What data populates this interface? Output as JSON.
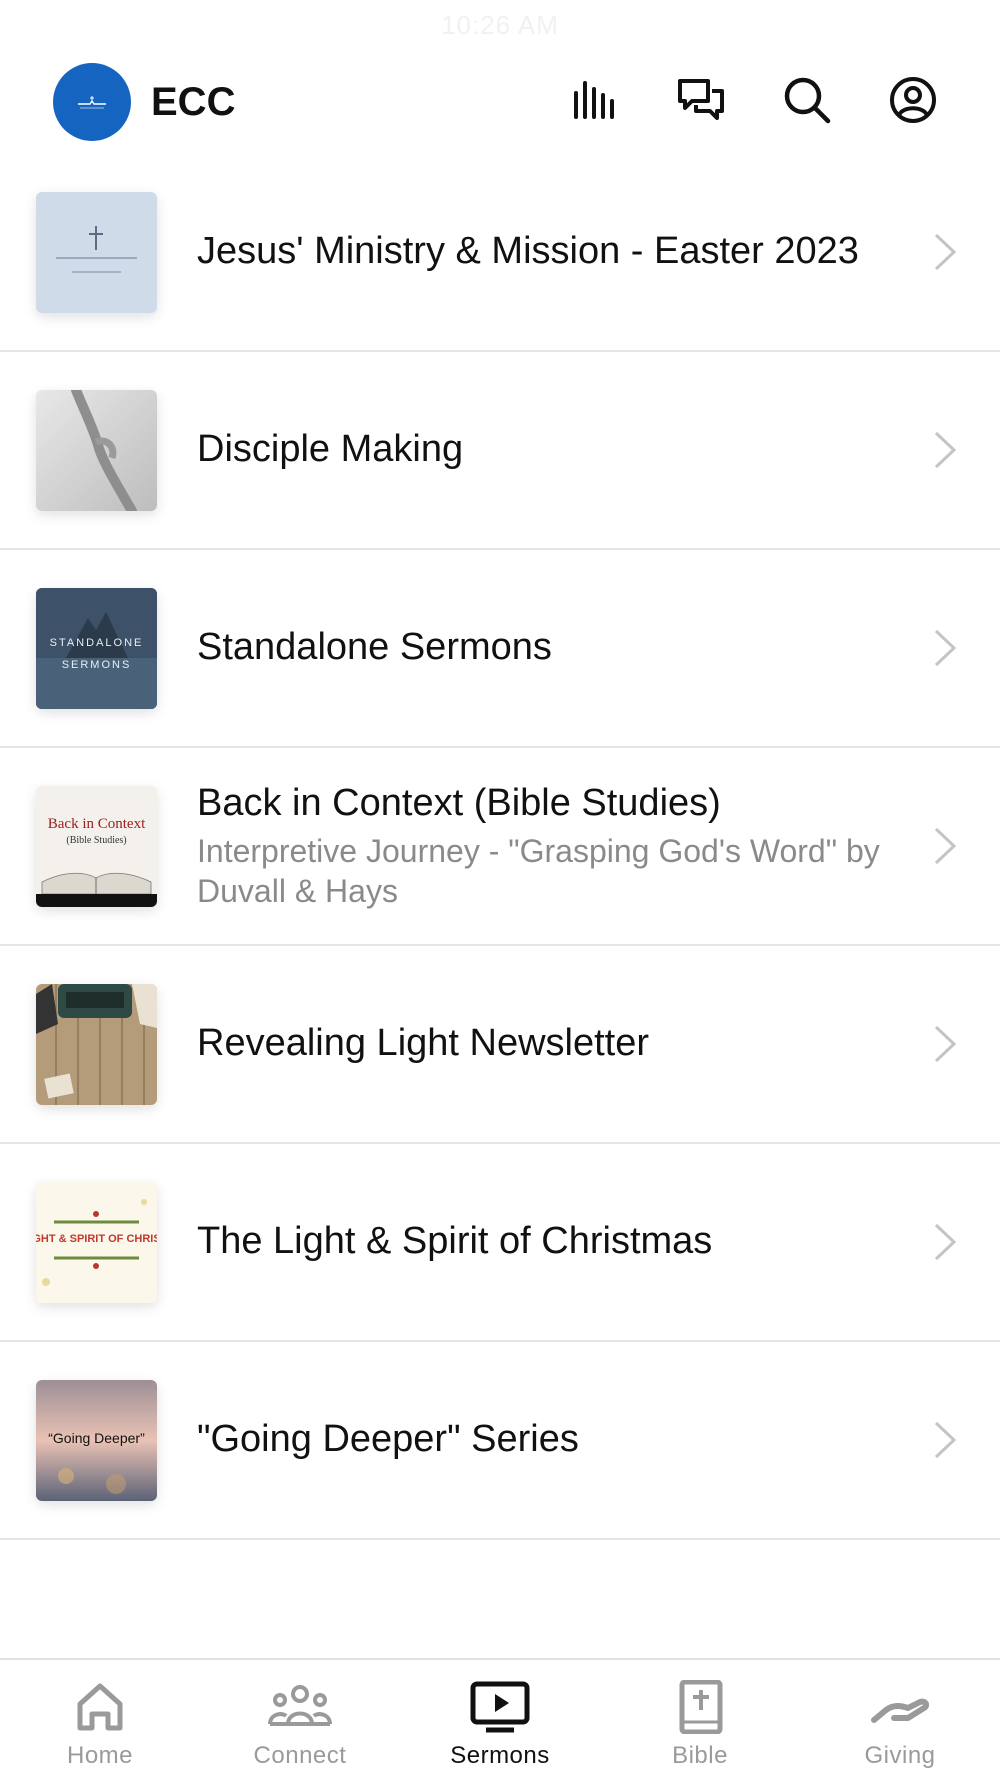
{
  "status_bar": {
    "time": "10:26 AM"
  },
  "header": {
    "app_name": "ECC",
    "icons": [
      "audio-bars-icon",
      "chat-icon",
      "search-icon",
      "account-icon"
    ]
  },
  "list": {
    "items": [
      {
        "title": "Jesus' Ministry & Mission - Easter 2023",
        "subtitle": "",
        "thumb_icon": "ministry-mission-thumbnail"
      },
      {
        "title": "Disciple Making",
        "subtitle": "",
        "thumb_icon": "hands-thumbnail"
      },
      {
        "title": "Standalone Sermons",
        "subtitle": "",
        "thumb_icon": "standalone-sermons-thumbnail",
        "thumb_text": [
          "STANDALONE",
          "SERMONS"
        ]
      },
      {
        "title": "Back in Context (Bible Studies)",
        "subtitle": "Interpretive Journey - \"Grasping God's Word\" by Duvall & Hays",
        "thumb_icon": "back-in-context-thumbnail",
        "thumb_text": [
          "Back in Context",
          "(Bible Studies)"
        ]
      },
      {
        "title": "Revealing Light Newsletter",
        "subtitle": "",
        "thumb_icon": "typewriter-thumbnail"
      },
      {
        "title": "The Light & Spirit of Christmas",
        "subtitle": "",
        "thumb_icon": "christmas-thumbnail",
        "thumb_text": [
          "GHT & SPIRIT OF CHRIS"
        ]
      },
      {
        "title": "\"Going Deeper\" Series",
        "subtitle": "",
        "thumb_icon": "going-deeper-thumbnail",
        "thumb_text": [
          "“Going Deeper”"
        ]
      }
    ]
  },
  "tabbar": {
    "tabs": [
      {
        "label": "Home",
        "icon": "home-icon",
        "active": false
      },
      {
        "label": "Connect",
        "icon": "people-icon",
        "active": false
      },
      {
        "label": "Sermons",
        "icon": "tv-play-icon",
        "active": true
      },
      {
        "label": "Bible",
        "icon": "bible-icon",
        "active": false
      },
      {
        "label": "Giving",
        "icon": "giving-hand-icon",
        "active": false
      }
    ]
  },
  "colors": {
    "brand": "#1565c0",
    "text": "#111111",
    "muted": "#8a8a8a",
    "inactive_tab": "#9a9a9a",
    "divider": "#e6e6e6"
  }
}
